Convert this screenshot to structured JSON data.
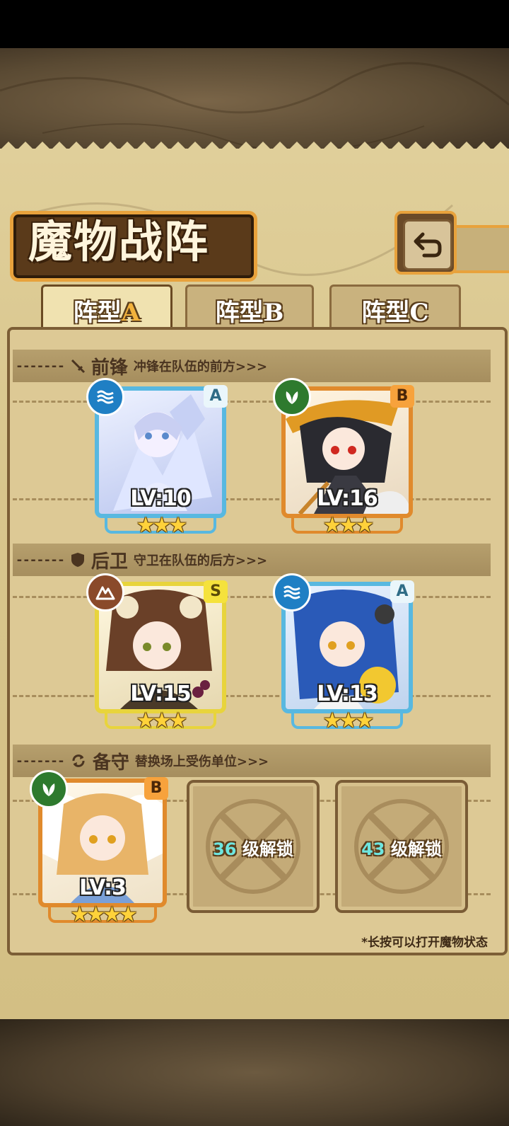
{
  "screen": {
    "title": "魔物战阵",
    "back_icon": "return-arrow-icon"
  },
  "tabs": [
    {
      "prefix": "阵型",
      "letter": "A",
      "active": true
    },
    {
      "prefix": "阵型",
      "letter": "B",
      "active": false
    },
    {
      "prefix": "阵型",
      "letter": "C",
      "active": false
    }
  ],
  "sections": {
    "front": {
      "icon": "sword-icon",
      "title": "前锋",
      "desc": "冲锋在队伍的前方>>>"
    },
    "rear": {
      "icon": "shield-icon",
      "title": "后卫",
      "desc": "守卫在队伍的后方>>>"
    },
    "reserve": {
      "icon": "swap-arrows-icon",
      "title": "备守",
      "desc": "替换场上受伤单位>>>"
    }
  },
  "units": {
    "front": [
      {
        "name": "ice-crystal-girl",
        "element": "water",
        "rank": "A",
        "level": "LV:10",
        "stars": "★★★",
        "frame_color": "#58b8e0"
      },
      {
        "name": "witch-girl",
        "element": "grass",
        "rank": "B",
        "level": "LV:16",
        "stars": "★★★",
        "frame_color": "#e08a2c"
      }
    ],
    "rear": [
      {
        "name": "sheep-girl",
        "element": "earth",
        "rank": "S",
        "level": "LV:15",
        "stars": "★★★",
        "frame_color": "#e8d43c"
      },
      {
        "name": "bell-cat-girl",
        "element": "water",
        "rank": "A",
        "level": "LV:13",
        "stars": "★★★",
        "frame_color": "#58b8e0"
      }
    ],
    "reserve": [
      {
        "name": "angel-girl",
        "element": "grass",
        "rank": "B",
        "level": "LV:3",
        "stars": "★★★★",
        "frame_color": "#e08a2c"
      }
    ]
  },
  "locked_slots": [
    {
      "level": "36",
      "suffix": "级解锁"
    },
    {
      "level": "43",
      "suffix": "级解锁"
    }
  ],
  "hint": "*长按可以打开魔物状态",
  "colors": {
    "accent_orange": "#e8a23c",
    "rank_a": "#58b8e0",
    "rank_b": "#e08a2c",
    "rank_s": "#e8d43c",
    "lock_number": "#6ee6e0"
  }
}
